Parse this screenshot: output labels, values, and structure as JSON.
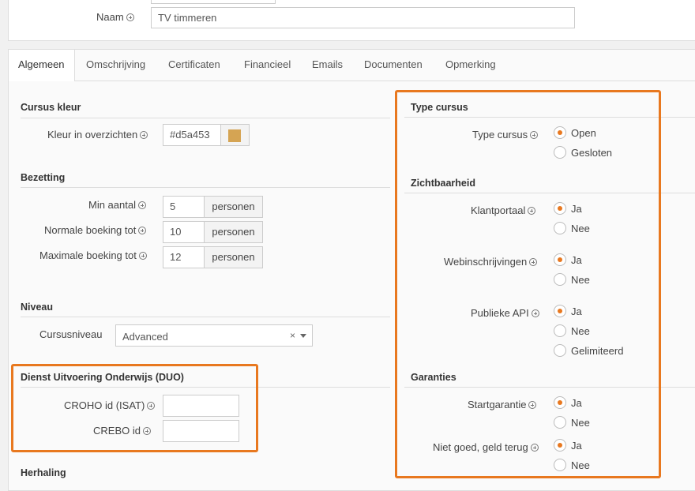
{
  "header": {
    "name_label": "Naam",
    "name_value": "TV timmeren"
  },
  "tabs": [
    {
      "label": "Algemeen"
    },
    {
      "label": "Omschrijving"
    },
    {
      "label": "Certificaten"
    },
    {
      "label": "Financieel"
    },
    {
      "label": "Emails"
    },
    {
      "label": "Documenten"
    },
    {
      "label": "Opmerking"
    }
  ],
  "left": {
    "cursus_kleur": {
      "title": "Cursus kleur",
      "kleur_label": "Kleur in overzichten",
      "kleur_value": "#d5a453",
      "swatch_color": "#d5a453"
    },
    "bezetting": {
      "title": "Bezetting",
      "min_label": "Min aantal",
      "min_value": "5",
      "normaal_label": "Normale boeking tot",
      "normaal_value": "10",
      "max_label": "Maximale boeking tot",
      "max_value": "12",
      "unit": "personen"
    },
    "niveau": {
      "title": "Niveau",
      "cursusniveau_label": "Cursusniveau",
      "cursusniveau_value": "Advanced",
      "clear_symbol": "×"
    },
    "duo": {
      "title": "Dienst Uitvoering Onderwijs (DUO)",
      "croho_label": "CROHO id (ISAT)",
      "croho_value": "",
      "crebo_label": "CREBO id",
      "crebo_value": ""
    },
    "herhaling": {
      "title": "Herhaling"
    }
  },
  "right": {
    "type_cursus": {
      "title": "Type cursus",
      "label": "Type cursus",
      "options": [
        "Open",
        "Gesloten"
      ],
      "selected": "Open"
    },
    "zichtbaarheid": {
      "title": "Zichtbaarheid",
      "klantportaal": {
        "label": "Klantportaal",
        "options": [
          "Ja",
          "Nee"
        ],
        "selected": "Ja"
      },
      "webinschrijvingen": {
        "label": "Webinschrijvingen",
        "options": [
          "Ja",
          "Nee"
        ],
        "selected": "Ja"
      },
      "publieke_api": {
        "label": "Publieke API",
        "options": [
          "Ja",
          "Nee",
          "Gelimiteerd"
        ],
        "selected": "Ja"
      }
    },
    "garanties": {
      "title": "Garanties",
      "startgarantie": {
        "label": "Startgarantie",
        "options": [
          "Ja",
          "Nee"
        ],
        "selected": "Ja"
      },
      "niet_goed": {
        "label": "Niet goed, geld terug",
        "options": [
          "Ja",
          "Nee"
        ],
        "selected": "Ja"
      }
    }
  },
  "colors": {
    "highlight": "#e8781f",
    "radio_dot": "#e8781f"
  }
}
